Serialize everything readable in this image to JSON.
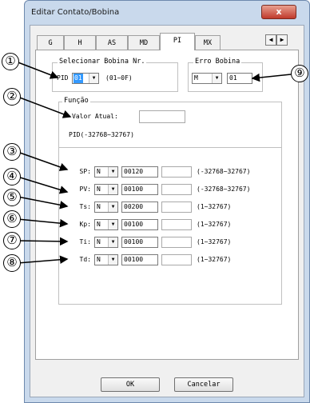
{
  "window": {
    "title": "Editar Contato/Bobina",
    "close_glyph": "x"
  },
  "tabs": [
    {
      "label": "G"
    },
    {
      "label": "H"
    },
    {
      "label": "AS"
    },
    {
      "label": "MD"
    },
    {
      "label": "PI"
    },
    {
      "label": "MX"
    }
  ],
  "tab_scroll": {
    "left": "◀",
    "right": "▶"
  },
  "selecionar": {
    "legend": "Selecionar Bobina Nr.",
    "prefix": "PID",
    "value": "01",
    "range": "(01~0F)"
  },
  "erro": {
    "legend": "Erro Bobina",
    "type": "M",
    "value": "01"
  },
  "funcao": {
    "legend": "Função",
    "valor_label": "Valor Atual:",
    "pid_range": "PID(-32768~32767)"
  },
  "params": [
    {
      "label": "SP:",
      "type": "N",
      "value": "00120",
      "range": "(-32768~32767)"
    },
    {
      "label": "PV:",
      "type": "N",
      "value": "00100",
      "range": "(-32768~32767)"
    },
    {
      "label": "Ts:",
      "type": "N",
      "value": "00200",
      "range": "(1~32767)"
    },
    {
      "label": "Kp:",
      "type": "N",
      "value": "00100",
      "range": "(1~32767)"
    },
    {
      "label": "Ti:",
      "type": "N",
      "value": "00100",
      "range": "(1~32767)"
    },
    {
      "label": "Td:",
      "type": "N",
      "value": "00100",
      "range": "(1~32767)"
    }
  ],
  "buttons": {
    "ok": "OK",
    "cancel": "Cancelar"
  },
  "callouts": [
    "①",
    "②",
    "③",
    "④",
    "⑤",
    "⑥",
    "⑦",
    "⑧",
    "⑨"
  ],
  "colors": {
    "selection": "#3399ff",
    "close": "#c0392b",
    "frame": "#c9d9ec"
  }
}
